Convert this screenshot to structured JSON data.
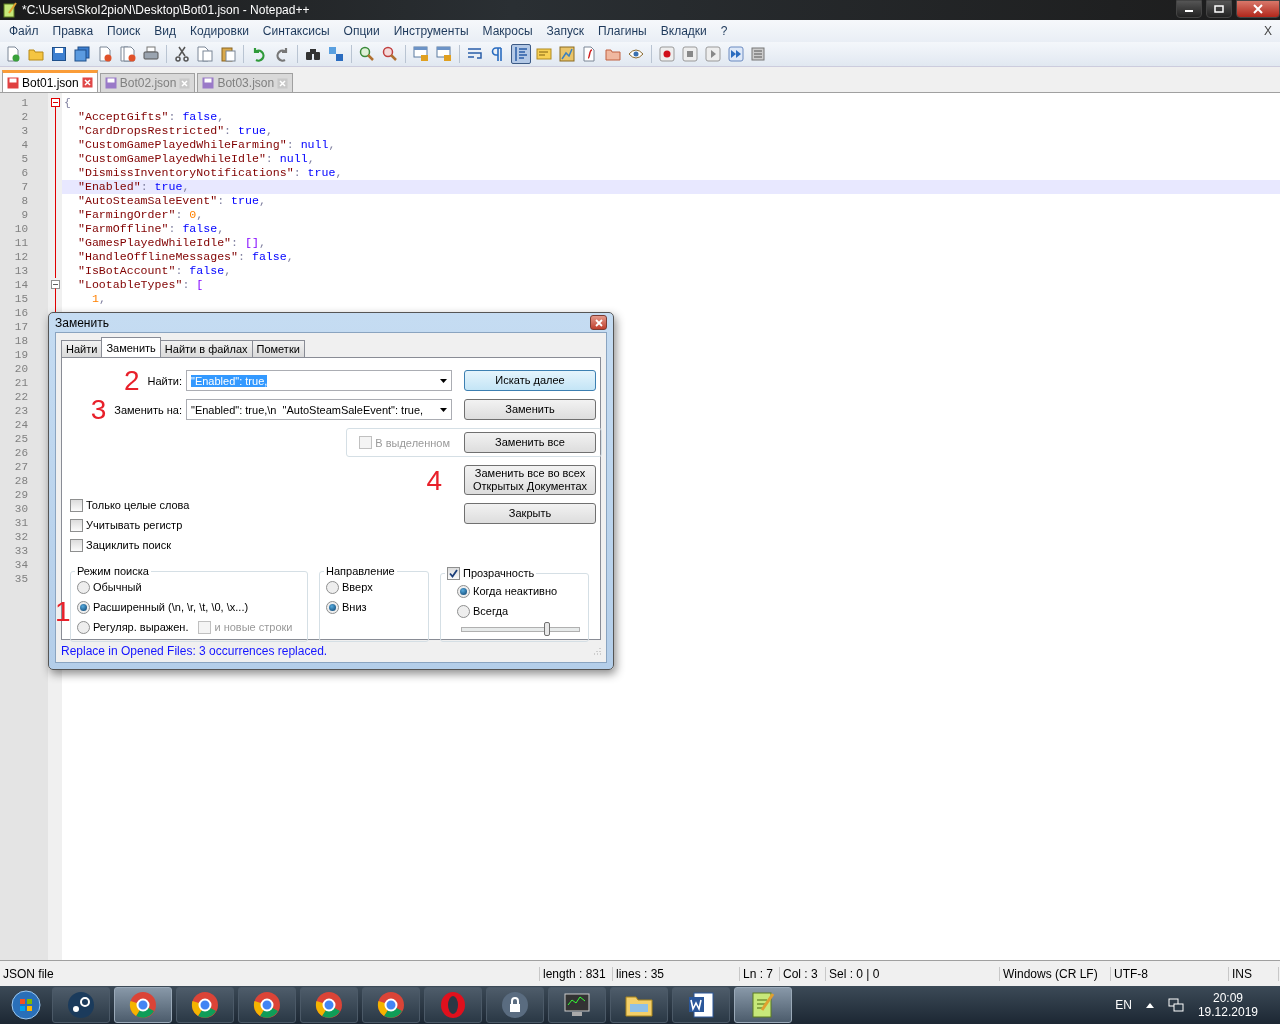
{
  "window": {
    "title": "*C:\\Users\\SkoI2pioN\\Desktop\\Bot01.json - Notepad++"
  },
  "menu": {
    "items": [
      "Файл",
      "Правка",
      "Поиск",
      "Вид",
      "Кодировки",
      "Синтаксисы",
      "Опции",
      "Инструменты",
      "Макросы",
      "Запуск",
      "Плагины",
      "Вкладки",
      "?"
    ],
    "close": "X"
  },
  "toolbar": {
    "groups": [
      {
        "buttons": [
          {
            "kind": "new",
            "pressed": false
          },
          {
            "kind": "open",
            "pressed": false
          },
          {
            "kind": "save",
            "pressed": false
          },
          {
            "kind": "save-all",
            "pressed": false
          },
          {
            "kind": "close",
            "pressed": false
          },
          {
            "kind": "close-all",
            "pressed": false
          },
          {
            "kind": "print",
            "pressed": false
          }
        ]
      },
      {
        "buttons": [
          {
            "kind": "cut",
            "pressed": false
          },
          {
            "kind": "copy",
            "pressed": false
          },
          {
            "kind": "paste",
            "pressed": false
          }
        ]
      },
      {
        "buttons": [
          {
            "kind": "undo",
            "pressed": false
          },
          {
            "kind": "redo",
            "pressed": false
          }
        ]
      },
      {
        "buttons": [
          {
            "kind": "find",
            "pressed": false
          },
          {
            "kind": "replace",
            "pressed": false
          }
        ]
      },
      {
        "buttons": [
          {
            "kind": "zoom-in",
            "pressed": false
          },
          {
            "kind": "zoom-out",
            "pressed": false
          }
        ]
      },
      {
        "buttons": [
          {
            "kind": "sync",
            "pressed": false
          },
          {
            "kind": "sync",
            "pressed": false
          }
        ]
      },
      {
        "buttons": [
          {
            "kind": "wrap",
            "pressed": false
          },
          {
            "kind": "pilcrow",
            "pressed": false
          },
          {
            "kind": "indent",
            "pressed": true
          },
          {
            "kind": "note",
            "pressed": false
          },
          {
            "kind": "map",
            "pressed": false
          },
          {
            "kind": "function",
            "pressed": false
          },
          {
            "kind": "folder",
            "pressed": false
          },
          {
            "kind": "eye",
            "pressed": false
          }
        ]
      },
      {
        "buttons": [
          {
            "kind": "record",
            "pressed": false
          },
          {
            "kind": "stop",
            "pressed": false
          },
          {
            "kind": "play",
            "pressed": false
          },
          {
            "kind": "play-multi",
            "pressed": false
          },
          {
            "kind": "macro-list",
            "pressed": false
          }
        ]
      }
    ]
  },
  "tabs": [
    {
      "label": "Bot01.json",
      "selected": true
    },
    {
      "label": "Bot02.json",
      "selected": false
    },
    {
      "label": "Bot03.json",
      "selected": false
    }
  ],
  "editor": {
    "line_numbers": [
      "1",
      "2",
      "3",
      "4",
      "5",
      "6",
      "7",
      "8",
      "9",
      "10",
      "11",
      "12",
      "13",
      "14",
      "15",
      "16",
      "17",
      "18",
      "19",
      "20",
      "21",
      "22",
      "23",
      "24",
      "25",
      "26",
      "27",
      "28",
      "29",
      "30",
      "31",
      "32",
      "33",
      "34",
      "35"
    ],
    "code": [
      {
        "current": false,
        "parts": [
          {
            "t": "{",
            "kind": "op"
          }
        ],
        "children": [
          {
            "current": false,
            "parts": [
              {
                "t": "\"AcceptGifts\"",
                "kind": "string"
              },
              {
                "t": ": ",
                "kind": "op"
              },
              {
                "t": "false",
                "kind": "keyword"
              },
              {
                "t": ",",
                "kind": "op"
              }
            ]
          },
          {
            "current": false,
            "parts": [
              {
                "t": "\"CardDropsRestricted\"",
                "kind": "string"
              },
              {
                "t": ": ",
                "kind": "op"
              },
              {
                "t": "true",
                "kind": "keyword"
              },
              {
                "t": ",",
                "kind": "op"
              }
            ]
          },
          {
            "current": false,
            "parts": [
              {
                "t": "\"CustomGamePlayedWhileFarming\"",
                "kind": "string"
              },
              {
                "t": ": ",
                "kind": "op"
              },
              {
                "t": "null",
                "kind": "keyword"
              },
              {
                "t": ",",
                "kind": "op"
              }
            ]
          },
          {
            "current": false,
            "parts": [
              {
                "t": "\"CustomGamePlayedWhileIdle\"",
                "kind": "string"
              },
              {
                "t": ": ",
                "kind": "op"
              },
              {
                "t": "null",
                "kind": "keyword"
              },
              {
                "t": ",",
                "kind": "op"
              }
            ]
          },
          {
            "current": false,
            "parts": [
              {
                "t": "\"DismissInventoryNotifications\"",
                "kind": "string"
              },
              {
                "t": ": ",
                "kind": "op"
              },
              {
                "t": "true",
                "kind": "keyword"
              },
              {
                "t": ",",
                "kind": "op"
              }
            ]
          },
          {
            "current": true,
            "parts": [
              {
                "t": "\"Enabled\"",
                "kind": "string"
              },
              {
                "t": ": ",
                "kind": "op"
              },
              {
                "t": "true",
                "kind": "keyword"
              },
              {
                "t": ",",
                "kind": "op"
              }
            ]
          },
          {
            "current": false,
            "parts": [
              {
                "t": "\"AutoSteamSaleEvent\"",
                "kind": "string"
              },
              {
                "t": ": ",
                "kind": "op"
              },
              {
                "t": "true",
                "kind": "keyword"
              },
              {
                "t": ",",
                "kind": "op"
              }
            ]
          },
          {
            "current": false,
            "parts": [
              {
                "t": "\"FarmingOrder\"",
                "kind": "string"
              },
              {
                "t": ": ",
                "kind": "op"
              },
              {
                "t": "0",
                "kind": "number"
              },
              {
                "t": ",",
                "kind": "op"
              }
            ]
          },
          {
            "current": false,
            "parts": [
              {
                "t": "\"FarmOffline\"",
                "kind": "string"
              },
              {
                "t": ": ",
                "kind": "op"
              },
              {
                "t": "false",
                "kind": "keyword"
              },
              {
                "t": ",",
                "kind": "op"
              }
            ]
          },
          {
            "current": false,
            "parts": [
              {
                "t": "\"GamesPlayedWhileIdle\"",
                "kind": "string"
              },
              {
                "t": ": ",
                "kind": "op"
              },
              {
                "t": "[]",
                "kind": "bracket"
              },
              {
                "t": ",",
                "kind": "op"
              }
            ]
          },
          {
            "current": false,
            "parts": [
              {
                "t": "\"HandleOfflineMessages\"",
                "kind": "string"
              },
              {
                "t": ": ",
                "kind": "op"
              },
              {
                "t": "false",
                "kind": "keyword"
              },
              {
                "t": ",",
                "kind": "op"
              }
            ]
          },
          {
            "current": false,
            "parts": [
              {
                "t": "\"IsBotAccount\"",
                "kind": "string"
              },
              {
                "t": ": ",
                "kind": "op"
              },
              {
                "t": "false",
                "kind": "keyword"
              },
              {
                "t": ",",
                "kind": "op"
              }
            ]
          },
          {
            "current": false,
            "parts": [
              {
                "t": "\"LootableTypes\"",
                "kind": "string"
              },
              {
                "t": ": ",
                "kind": "op"
              },
              {
                "t": "[",
                "kind": "bracket"
              }
            ],
            "children": [
              {
                "current": false,
                "parts": [
                  {
                    "t": "1",
                    "kind": "number"
                  },
                  {
                    "t": ",",
                    "kind": "op"
                  }
                ]
              }
            ]
          }
        ]
      }
    ]
  },
  "dialog": {
    "title": "Заменить",
    "tabs": [
      {
        "label": "Найти",
        "selected": false
      },
      {
        "label": "Заменить",
        "selected": true
      },
      {
        "label": "Найти в файлах",
        "selected": false
      },
      {
        "label": "Пометки",
        "selected": false
      }
    ],
    "find": {
      "annotation": "2",
      "label": "Найти:",
      "value": "\"Enabled\": true,",
      "selected": true
    },
    "replace": {
      "annotation": "3",
      "label": "Заменить на:",
      "value": "\"Enabled\": true,\\n  \"AutoSteamSaleEvent\": true,",
      "selected": false
    },
    "in_selection": {
      "label": "В выделенном",
      "checked": false,
      "disabled": true
    },
    "buttons": [
      {
        "label": "Искать далее",
        "default": true
      },
      {
        "label": "Заменить",
        "default": false
      },
      {
        "label": "Заменить все",
        "default": false
      },
      {
        "label": "Заменить все во всех\nОткрытых Документах",
        "default": false
      },
      {
        "label": "Закрыть",
        "default": false
      }
    ],
    "annotation_4": "4",
    "options": [
      {
        "label": "Только целые слова",
        "checked": false
      },
      {
        "label": "Учитывать регистр",
        "checked": false
      },
      {
        "label": "Зациклить поиск",
        "checked": false
      }
    ],
    "search_mode": {
      "title": "Режим поиска",
      "annotation": "1",
      "options": [
        {
          "label": "Обычный",
          "selected": false
        },
        {
          "label": "Расширенный (\\n, \\r, \\t, \\0, \\x...)",
          "selected": true
        },
        {
          "label": "Регуляр. выражен.",
          "selected": false
        }
      ],
      "newlines": {
        "label": "и новые строки",
        "checked": false,
        "disabled": true
      }
    },
    "direction": {
      "title": "Направление",
      "options": [
        {
          "label": "Вверх",
          "selected": false
        },
        {
          "label": "Вниз",
          "selected": true
        }
      ]
    },
    "transparency": {
      "label": "Прозрачность",
      "checked": true,
      "options": [
        {
          "label": "Когда неактивно",
          "selected": true
        },
        {
          "label": "Всегда",
          "selected": false
        }
      ],
      "level": 0.72
    },
    "status": "Replace in Opened Files: 3 occurrences replaced."
  },
  "status_bar": {
    "type": "JSON file",
    "length": "length : 831",
    "lines": "lines : 35",
    "ln": "Ln : 7",
    "col": "Col : 3",
    "sel": "Sel : 0 | 0",
    "eol": "Windows (CR LF)",
    "encoding": "UTF-8",
    "mode": "INS"
  },
  "taskbar": {
    "items": [
      {
        "kind": "start",
        "selected": false
      },
      {
        "kind": "steam",
        "selected": false
      },
      {
        "kind": "chrome",
        "selected": true
      },
      {
        "kind": "chrome",
        "selected": false
      },
      {
        "kind": "chrome",
        "selected": false
      },
      {
        "kind": "chrome",
        "selected": false
      },
      {
        "kind": "chrome",
        "selected": false
      },
      {
        "kind": "opera",
        "selected": false
      },
      {
        "kind": "lock",
        "selected": false
      },
      {
        "kind": "monitor",
        "selected": false
      },
      {
        "kind": "explorer",
        "selected": false
      },
      {
        "kind": "word",
        "selected": false
      },
      {
        "kind": "notepad",
        "selected": true
      }
    ],
    "language": "EN",
    "time": "20:09",
    "date": "19.12.2019"
  }
}
